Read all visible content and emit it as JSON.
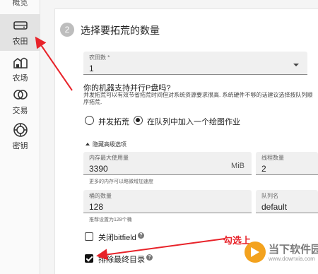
{
  "sidebar": {
    "top_partial_label": "概览",
    "items": [
      {
        "label": "农田",
        "icon": "hard-drive-icon",
        "active": true
      },
      {
        "label": "农场",
        "icon": "farm-icon",
        "active": false
      },
      {
        "label": "交易",
        "icon": "trade-icon",
        "active": false
      },
      {
        "label": "密钥",
        "icon": "key-icon",
        "active": false
      }
    ]
  },
  "step": {
    "number": "2",
    "title": "选择要拓荒的数量"
  },
  "plot_count": {
    "label": "农田数 *",
    "value": "1"
  },
  "parallel": {
    "question": "你的机器支持并行P盘吗?",
    "description": "并发拓荒可以有效节省拓荒时间但对系统资源要求很高. 系统硬件不够的话建议选择按队列顺序拓荒.",
    "options": [
      {
        "label": "并发拓荒",
        "checked": false
      },
      {
        "label": "在队列中加入一个绘图作业",
        "checked": true
      }
    ]
  },
  "advanced": {
    "toggle_label": "隐藏高级选项",
    "max_memory": {
      "label": "内存最大使用量",
      "value": "3390",
      "unit": "MiB",
      "helper": "更多的内存可以略微增加速度"
    },
    "threads": {
      "label": "线程数量",
      "value": "2"
    },
    "buckets": {
      "label": "桶的数量",
      "value": "128",
      "helper": "推荐设置为128个桶"
    },
    "queue": {
      "label": "队列名",
      "value": "default"
    }
  },
  "checkboxes": {
    "disable_bitfield": {
      "label": "关闭bitfield",
      "checked": false
    },
    "exclude_final_dir": {
      "label": "排除最终目录",
      "checked": true
    }
  },
  "annotation": {
    "text": "勾选上",
    "color": "#e8232a"
  },
  "watermark": {
    "title": "当下软件园",
    "url": "www.downxia.com"
  }
}
